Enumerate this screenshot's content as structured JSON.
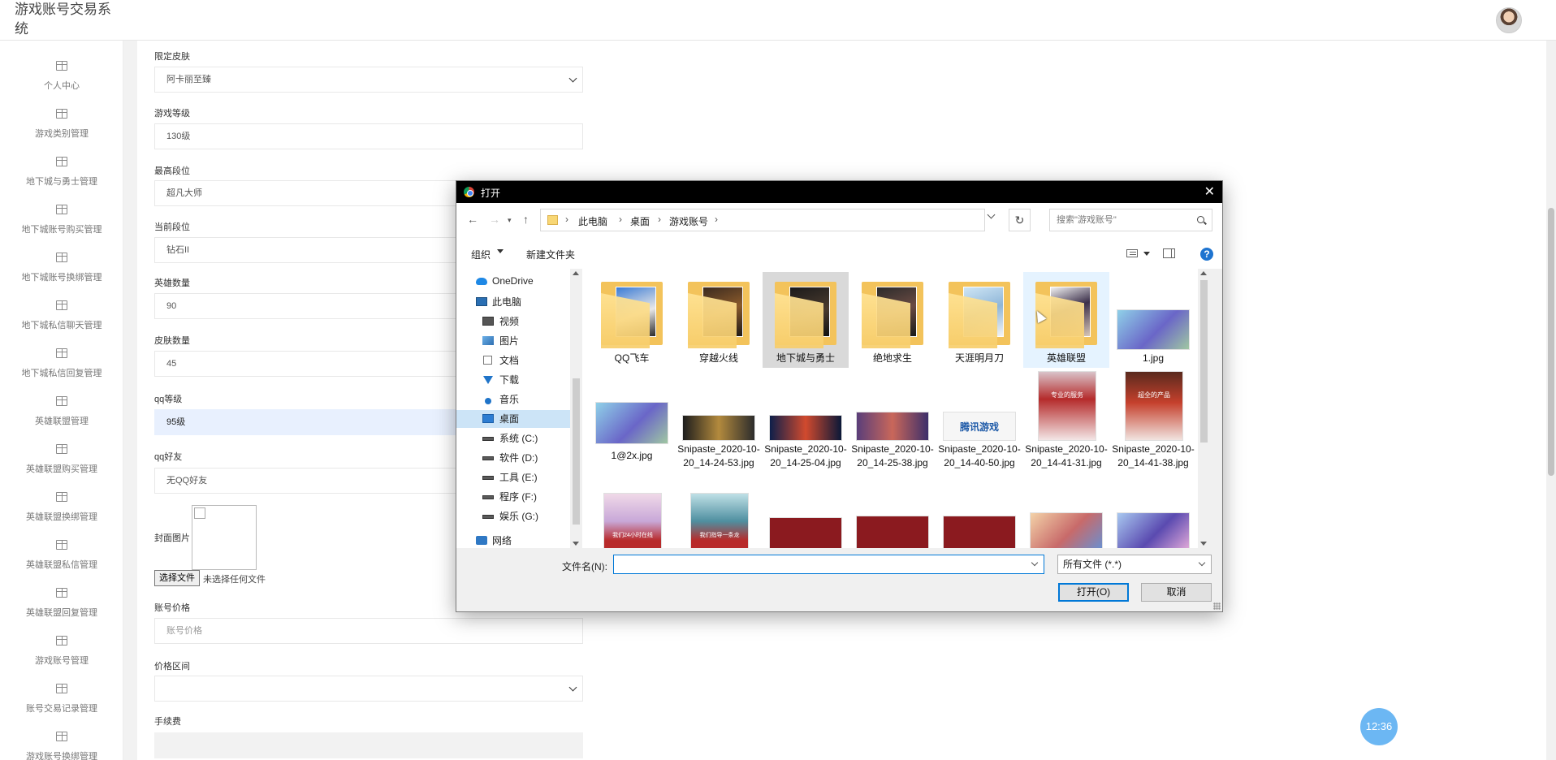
{
  "app": {
    "title": "游戏账号交易系统"
  },
  "sidebar": {
    "items": [
      {
        "label": "个人中心"
      },
      {
        "label": "游戏类别管理"
      },
      {
        "label": "地下城与勇士管理"
      },
      {
        "label": "地下城账号购买管理"
      },
      {
        "label": "地下城账号换绑管理"
      },
      {
        "label": "地下城私信聊天管理"
      },
      {
        "label": "地下城私信回复管理"
      },
      {
        "label": "英雄联盟管理"
      },
      {
        "label": "英雄联盟购买管理"
      },
      {
        "label": "英雄联盟换绑管理"
      },
      {
        "label": "英雄联盟私信管理"
      },
      {
        "label": "英雄联盟回复管理"
      },
      {
        "label": "游戏账号管理"
      },
      {
        "label": "账号交易记录管理"
      },
      {
        "label": "游戏账号换绑管理"
      }
    ]
  },
  "form": {
    "fields": [
      {
        "label": "限定皮肤",
        "value": "阿卡丽至臻",
        "type": "select"
      },
      {
        "label": "游戏等级",
        "value": "130级",
        "type": "input"
      },
      {
        "label": "最高段位",
        "value": "超凡大师",
        "type": "input"
      },
      {
        "label": "当前段位",
        "value": "钻石II",
        "type": "input"
      },
      {
        "label": "英雄数量",
        "value": "90",
        "type": "input"
      },
      {
        "label": "皮肤数量",
        "value": "45",
        "type": "input"
      },
      {
        "label": "qq等级",
        "value": "95级",
        "type": "input"
      },
      {
        "label": "qq好友",
        "value": "无QQ好友",
        "type": "input"
      }
    ],
    "cover": {
      "label": "封面图片",
      "file_button": "选择文件",
      "file_status": "未选择任何文件"
    },
    "price": {
      "label": "账号价格",
      "placeholder": "账号价格"
    },
    "price_range": {
      "label": "价格区间",
      "value": ""
    },
    "fee": {
      "label": "手续费"
    }
  },
  "clock": "12:36",
  "dialog": {
    "title": "打开",
    "breadcrumb": [
      "此电脑",
      "桌面",
      "游戏账号"
    ],
    "search_placeholder": "搜索\"游戏账号\"",
    "toolbar": {
      "organize": "组织",
      "new_folder": "新建文件夹",
      "help": "?"
    },
    "nav_items": [
      {
        "label": "OneDrive",
        "icon": "cloud-icon"
      },
      {
        "label": "此电脑",
        "icon": "computer-icon"
      },
      {
        "label": "视频",
        "icon": "video-icon"
      },
      {
        "label": "图片",
        "icon": "pictures-icon"
      },
      {
        "label": "文档",
        "icon": "documents-icon"
      },
      {
        "label": "下载",
        "icon": "download-icon"
      },
      {
        "label": "音乐",
        "icon": "music-icon"
      },
      {
        "label": "桌面",
        "icon": "desktop-icon"
      },
      {
        "label": "系统 (C:)",
        "icon": "drive-icon"
      },
      {
        "label": "软件 (D:)",
        "icon": "drive-icon"
      },
      {
        "label": "工具 (E:)",
        "icon": "drive-icon"
      },
      {
        "label": "程序 (F:)",
        "icon": "drive-icon"
      },
      {
        "label": "娱乐 (G:)",
        "icon": "drive-icon"
      },
      {
        "label": "网络",
        "icon": "network-icon"
      }
    ],
    "files": [
      {
        "name": "QQ飞车",
        "kind": "folder"
      },
      {
        "name": "穿越火线",
        "kind": "folder"
      },
      {
        "name": "地下城与勇士",
        "kind": "folder"
      },
      {
        "name": "绝地求生",
        "kind": "folder"
      },
      {
        "name": "天涯明月刀",
        "kind": "folder"
      },
      {
        "name": "英雄联盟",
        "kind": "folder"
      },
      {
        "name": "1.jpg",
        "kind": "image"
      },
      {
        "name": "1@2x.jpg",
        "kind": "image"
      },
      {
        "name": "Snipaste_2020-10-20_14-24-53.jpg",
        "kind": "image"
      },
      {
        "name": "Snipaste_2020-10-20_14-25-04.jpg",
        "kind": "image"
      },
      {
        "name": "Snipaste_2020-10-20_14-25-38.jpg",
        "kind": "image"
      },
      {
        "name": "Snipaste_2020-10-20_14-40-50.jpg",
        "kind": "image"
      },
      {
        "name": "Snipaste_2020-10-20_14-41-31.jpg",
        "kind": "image"
      },
      {
        "name": "Snipaste_2020-10-20_14-41-38.jpg",
        "kind": "image"
      }
    ],
    "thumb_captions": {
      "tencent": "腾讯游戏",
      "service": "专业的服务",
      "product": "超全的产品",
      "online": "我们24小时在线",
      "guide": "我们指导一条龙"
    },
    "filename_label": "文件名(N):",
    "filename_value": "",
    "filetype": "所有文件 (*.*)",
    "open_button": "打开(O)",
    "cancel_button": "取消"
  },
  "colors": {
    "accent": "#0078d7",
    "selection": "#cce4f7",
    "folder": "#f3c35b",
    "clock_bg": "#6cb7f3"
  }
}
